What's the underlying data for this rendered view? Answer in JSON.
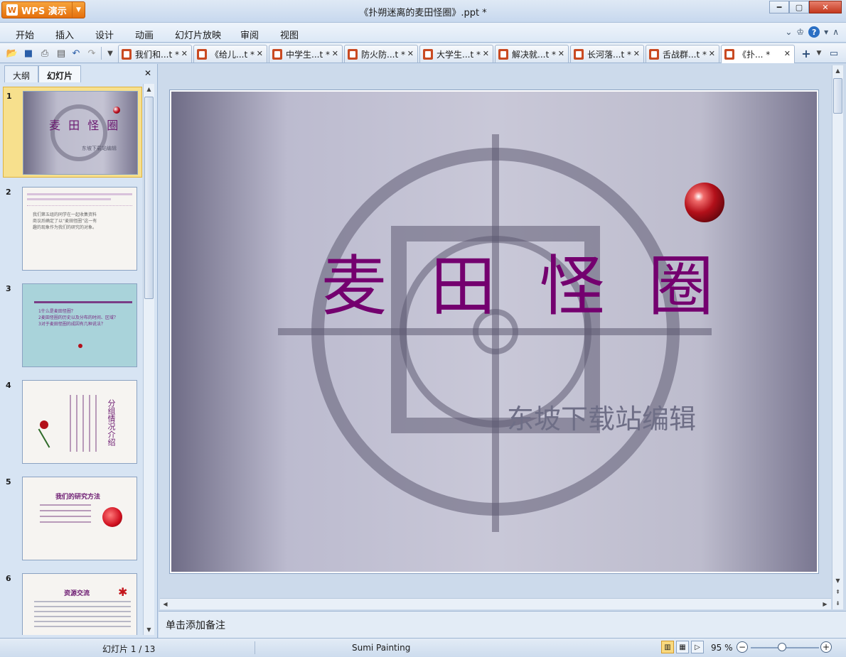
{
  "window": {
    "app_button": "WPS 演示",
    "title": "《扑朔迷离的麦田怪圈》.ppt *"
  },
  "menu": [
    "开始",
    "插入",
    "设计",
    "动画",
    "幻灯片放映",
    "审阅",
    "视图"
  ],
  "doc_tabs": [
    {
      "label": "我们和...t *"
    },
    {
      "label": "《给儿...t *"
    },
    {
      "label": "中学生...t *"
    },
    {
      "label": "防火防...t *"
    },
    {
      "label": "大学生...t *"
    },
    {
      "label": "解决就...t *"
    },
    {
      "label": "长河落...t *"
    },
    {
      "label": "舌战群...t *"
    },
    {
      "label": "《扑... *"
    }
  ],
  "panel": {
    "tabs": [
      "大纲",
      "幻灯片"
    ],
    "active_tab": "幻灯片"
  },
  "thumbnails": [
    {
      "num": "1",
      "title": "麦 田 怪 圈",
      "sub": "东坡下载站编辑"
    },
    {
      "num": "2",
      "title": "",
      "lines": [
        "我们第五组的同学在一起收集资料",
        "商议后确定了以“麦田怪圈”这一有",
        "趣的现象作为我们的研究的对象。"
      ]
    },
    {
      "num": "3",
      "title": "",
      "lines": [
        "1什么是麦田怪圈？",
        "2麦田怪圈的历史以及分布的时间、区域？",
        "3对于麦田怪圈的成因有几种说法？"
      ]
    },
    {
      "num": "4",
      "title": "分组情况介绍"
    },
    {
      "num": "5",
      "title": "我们的研究方法"
    },
    {
      "num": "6",
      "title": "资源交流"
    }
  ],
  "slide": {
    "title": "麦 田 怪 圈",
    "subtitle": "东坡下载站编辑"
  },
  "notes_placeholder": "单击添加备注",
  "status": {
    "slide_counter": "幻灯片 1 / 13",
    "theme": "Sumi Painting",
    "zoom": "95 %"
  },
  "colors": {
    "title_purple": "#74006f",
    "app_orange": "#e46f0d"
  }
}
